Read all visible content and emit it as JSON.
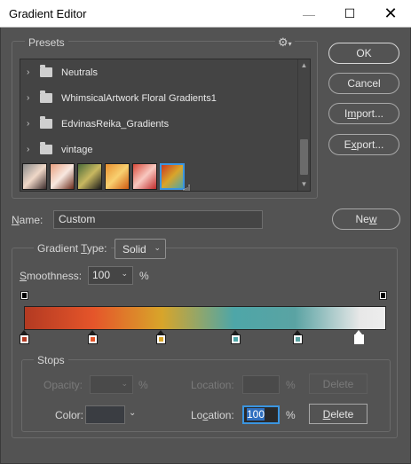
{
  "window": {
    "title": "Gradient Editor",
    "min_glyph": "—",
    "max_glyph": "☐",
    "close_glyph": "✕"
  },
  "presets": {
    "label": "Presets",
    "gear_glyph": "⚙",
    "folders": [
      {
        "label": "Neutrals"
      },
      {
        "label": "WhimsicalArtwork Floral Gradients1"
      },
      {
        "label": "EdvinasReika_Gradients"
      },
      {
        "label": "vintage"
      }
    ],
    "swatches": [
      {
        "c1": "#8a8a8a",
        "c2": "#f0d8c8",
        "c3": "#3a2a2a"
      },
      {
        "c1": "#e8a080",
        "c2": "#f8e8e0",
        "c3": "#6a2a1a"
      },
      {
        "c1": "#4a6a3a",
        "c2": "#c8b860",
        "c3": "#1a1a1a"
      },
      {
        "c1": "#e89030",
        "c2": "#f8d070",
        "c3": "#d05a10"
      },
      {
        "c1": "#d84a3a",
        "c2": "#f8c8c0",
        "c3": "#c02a2a"
      },
      {
        "c1": "#c83a22",
        "c2": "#d8a52a",
        "c3": "#4ea6a8"
      }
    ],
    "chevron_glyph": "›"
  },
  "buttons": {
    "ok": "OK",
    "cancel": "Cancel",
    "import_pre": "I",
    "import_u": "m",
    "import_post": "port...",
    "export_pre": "E",
    "export_u": "x",
    "export_post": "port...",
    "new_pre": "Ne",
    "new_u": "w",
    "new_post": ""
  },
  "name": {
    "label_pre": "",
    "label_u": "N",
    "label_post": "ame:",
    "value": "Custom"
  },
  "gradient": {
    "type_label_pre": "Gradient ",
    "type_label_u": "T",
    "type_label_post": "ype:",
    "type_value": "Solid",
    "smooth_label_pre": "",
    "smooth_label_u": "S",
    "smooth_label_post": "moothness:",
    "smooth_value": "100",
    "smooth_unit": "%",
    "color_stops": [
      {
        "color": "#b33a22"
      },
      {
        "color": "#e5552a"
      },
      {
        "color": "#d8a52a"
      },
      {
        "color": "#4ea6a8"
      },
      {
        "color": "#5aa3a3"
      },
      {
        "color": "#ffffff"
      }
    ]
  },
  "stops": {
    "label": "Stops",
    "opacity_label": "Opacity:",
    "opacity_unit": "%",
    "location_top_label": "Location:",
    "location_top_unit": "%",
    "delete_top": "Delete",
    "color_label": "Color:",
    "location_bottom_label_pre": "Lo",
    "location_bottom_label_u": "c",
    "location_bottom_label_post": "ation:",
    "location_bottom_value": "100",
    "location_bottom_unit": "%",
    "delete_bottom_pre": "",
    "delete_bottom_u": "D",
    "delete_bottom_post": "elete",
    "dropdown_glyph": "⌄",
    "swatch_color": "#3a3d42"
  }
}
